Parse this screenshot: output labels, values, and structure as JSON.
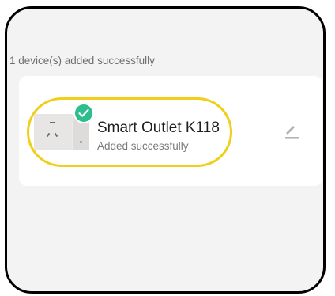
{
  "summary": {
    "text": "1 device(s) added successfully"
  },
  "device": {
    "name": "Smart Outlet K118",
    "status": "Added successfully",
    "thumbnail_icon": "smart-outlet-thumbnail",
    "badge_icon": "check-icon",
    "edit_icon": "pencil-icon"
  },
  "colors": {
    "success_badge": "#2ebd8d",
    "highlight": "#f0cf1a",
    "background": "#f3f3f4",
    "card": "#ffffff"
  }
}
